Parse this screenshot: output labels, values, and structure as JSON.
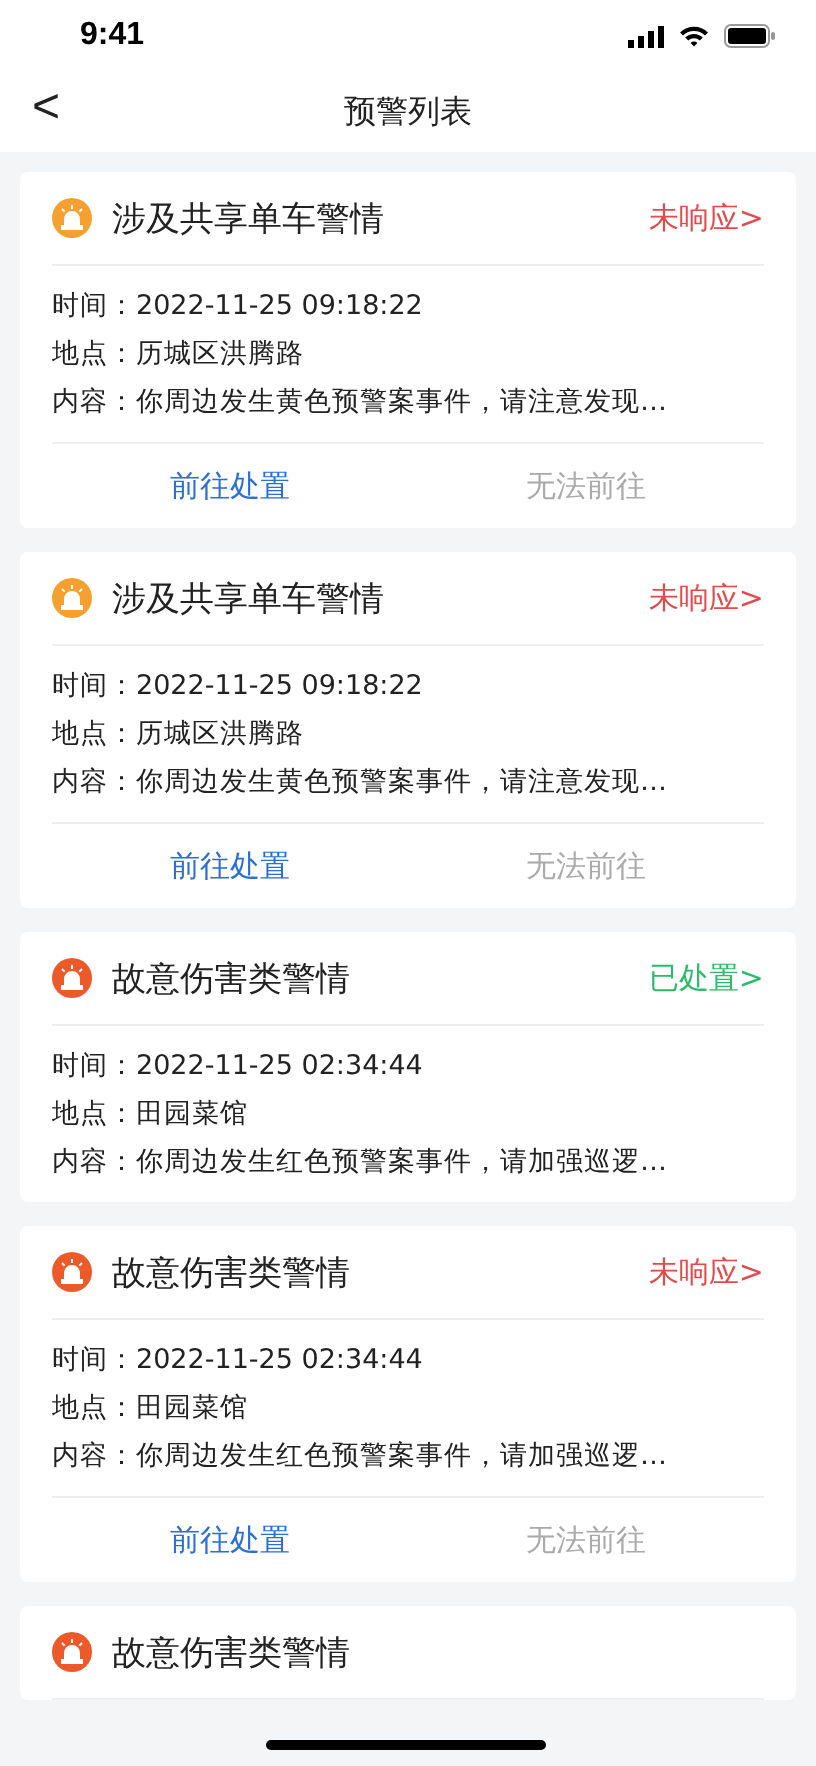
{
  "status_bar": {
    "time": "9:41"
  },
  "nav": {
    "back": "<",
    "title": "预警列表"
  },
  "alerts": [
    {
      "title": "涉及共享单车警情",
      "color": "#f5a030",
      "status": {
        "kind": "unresponded",
        "text": "未响应>"
      },
      "time": "时间：2022-11-25 09:18:22",
      "place": "地点：历城区洪腾路",
      "content": "内容：你周边发生黄色预警案事件，请注意发现…",
      "actions": [
        {
          "label": "前往处置",
          "disabled": false
        },
        {
          "label": "无法前往",
          "disabled": true
        }
      ]
    },
    {
      "title": "涉及共享单车警情",
      "color": "#f5a030",
      "status": {
        "kind": "unresponded",
        "text": "未响应>"
      },
      "time": "时间：2022-11-25 09:18:22",
      "place": "地点：历城区洪腾路",
      "content": "内容：你周边发生黄色预警案事件，请注意发现…",
      "actions": [
        {
          "label": "前往处置",
          "disabled": false
        },
        {
          "label": "无法前往",
          "disabled": true
        }
      ]
    },
    {
      "title": "故意伤害类警情",
      "color": "#ec5a2a",
      "status": {
        "kind": "handled",
        "text": "已处置>"
      },
      "time": "时间：2022-11-25 02:34:44",
      "place": "地点：田园菜馆",
      "content": "内容：你周边发生红色预警案事件，请加强巡逻…"
    },
    {
      "title": "故意伤害类警情",
      "color": "#ec5a2a",
      "status": {
        "kind": "unresponded",
        "text": "未响应>"
      },
      "time": "时间：2022-11-25 02:34:44",
      "place": "地点：田园菜馆",
      "content": "内容：你周边发生红色预警案事件，请加强巡逻…",
      "actions": [
        {
          "label": "前往处置",
          "disabled": false
        },
        {
          "label": "无法前往",
          "disabled": true
        }
      ]
    },
    {
      "title": "故意伤害类警情",
      "color": "#ec5a2a"
    }
  ]
}
